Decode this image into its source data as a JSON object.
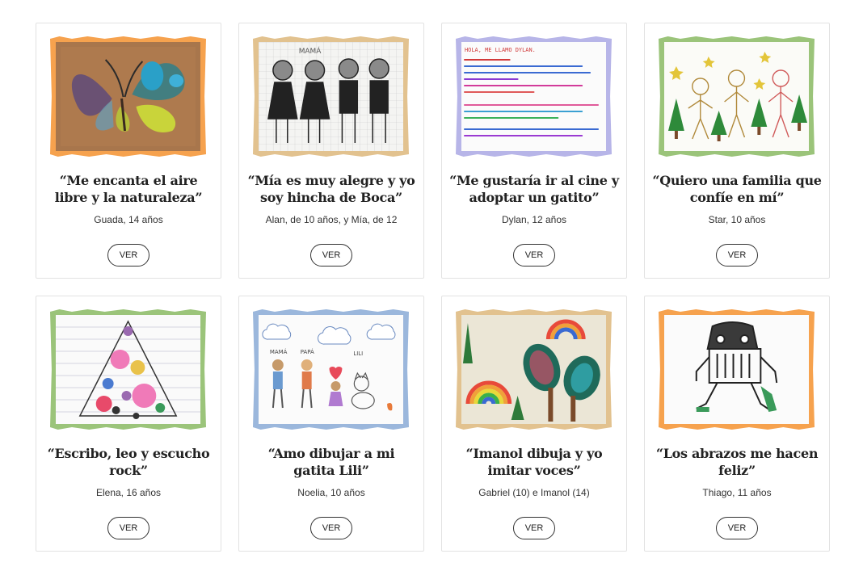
{
  "cards": [
    {
      "quote": "“Me encanta el aire libre y la naturaleza”",
      "author": "Guada, 14 años",
      "button": "VER",
      "frame_color": "#f6a24e",
      "image": "butterfly-drawing"
    },
    {
      "quote": "“Mía es muy alegre y yo soy hincha de Boca”",
      "author": "Alan, de 10 años, y Mía, de 12",
      "button": "VER",
      "frame_color": "#e2c28f",
      "image": "family-pencil-drawing",
      "drawing_text": "MAMÁ"
    },
    {
      "quote": "“Me gustaría ir al cine y adoptar un gatito”",
      "author": "Dylan, 12 años",
      "button": "VER",
      "frame_color": "#b7b5e8",
      "image": "handwritten-letter",
      "drawing_text": "HOLA, ME LLAMO DYLAN."
    },
    {
      "quote": "“Quiero una familia que confíe en mí”",
      "author": "Star, 10 años",
      "button": "VER",
      "frame_color": "#9bc47a",
      "image": "stick-figures-trees"
    },
    {
      "quote": "“Escribo, leo y escucho rock”",
      "author": "Elena, 16 años",
      "button": "VER",
      "frame_color": "#9bc47a",
      "image": "flower-triangle-drawing"
    },
    {
      "quote": "“Amo dibujar a mi gatita Lili”",
      "author": "Noelia, 10 años",
      "button": "VER",
      "frame_color": "#9bb7dc",
      "image": "family-cat-drawing",
      "drawing_labels": [
        "MAMÁ",
        "PAPÁ",
        "LILI"
      ]
    },
    {
      "quote": "“Imanol dibuja y yo imitar voces”",
      "author": "Gabriel (10) e Imanol (14)",
      "button": "VER",
      "frame_color": "#e2c28f",
      "image": "rainbow-trees-drawing"
    },
    {
      "quote": "“Los abrazos me hacen feliz”",
      "author": "Thiago, 11 años",
      "button": "VER",
      "frame_color": "#f6a24e",
      "image": "robot-figure-drawing"
    }
  ]
}
